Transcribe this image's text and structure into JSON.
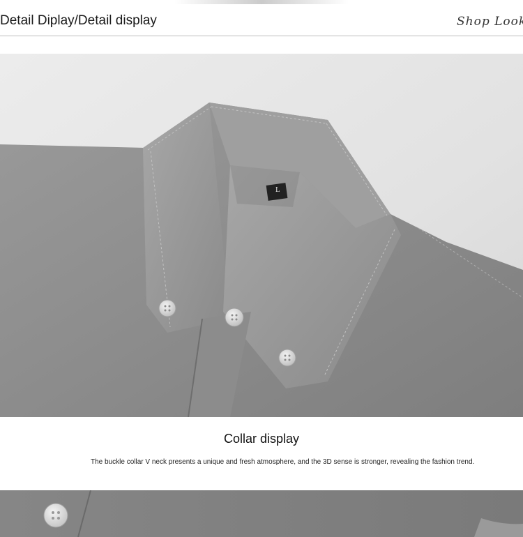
{
  "header": {
    "title": "Detail Diplay/Detail display",
    "shop_link": "Shop Look>"
  },
  "images": [
    {
      "name": "shirt-collar-photo",
      "alt": "Grey oxford shirt button-down collar close-up"
    },
    {
      "name": "shirt-front-photo",
      "alt": "Grey oxford shirt front with buttons"
    }
  ],
  "collar_tag": "L",
  "caption": {
    "title": "Collar display",
    "text": "The buckle collar V neck presents a unique and fresh atmosphere, and the 3D sense is stronger, revealing the fashion trend."
  },
  "colors": {
    "fabric": "#8f8f8f",
    "fabric_light": "#a3a3a3",
    "fabric_dark": "#6f6f6f",
    "button": "#d9d9d9",
    "divider": "#bdbdbd"
  }
}
